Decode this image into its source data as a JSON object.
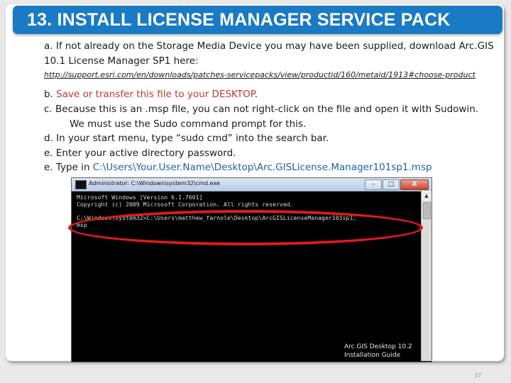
{
  "slide": {
    "title": "13. INSTALL LICENSE MANAGER SERVICE PACK",
    "page_number": "37"
  },
  "instructions": {
    "a_line1": "a. If not already on the Storage Media Device you may have been supplied, download Arc.GIS",
    "a_line2": "10.1 License Manager  SP1 here:",
    "url": "http://support.esri.com/en/downloads/patches-servicepacks/view/productid/160/metaid/1913#choose-product",
    "b_prefix": "b. ",
    "b_text": "Save or transfer this file to your DESKTOP",
    "b_suffix": ".",
    "c_line1": "c. Because this is an .msp file, you can not right-click on the file and open it with Sudowin.",
    "c_line2": "We must use the Sudo command prompt for this.",
    "d_line": "d. In your start menu, type “sudo cmd” into the search bar.",
    "e1_line": "e. Enter your active directory password.",
    "e2_prefix": "e. Type in ",
    "e2_path": "C:\\Users\\Your.User.Name\\Desktop\\Arc.GISLicense.Manager101sp1.msp"
  },
  "console": {
    "window_title": "Administrator: C:\\Windows\\system32\\cmd.exe",
    "minimize": "–",
    "maximize": "□",
    "close": "X",
    "line1": "Microsoft Windows [Version 6.1.7601]",
    "line2": "Copyright (c) 2009 Microsoft Corporation.  All rights reserved.",
    "line3": "C:\\Windows\\system32>C:\\Users\\matthew_farnole\\Desktop\\ArcGISLicenseManager101sp1.",
    "line4": "msp",
    "scroll_up": "▲",
    "caption": "Arc.GIS Desktop 10.2 Installation Guide"
  },
  "colors": {
    "title_bar": "#1a7ac4",
    "highlight_red": "#c0392b",
    "path_blue": "#1f5fa8",
    "ellipse_red": "#e01b1b"
  }
}
